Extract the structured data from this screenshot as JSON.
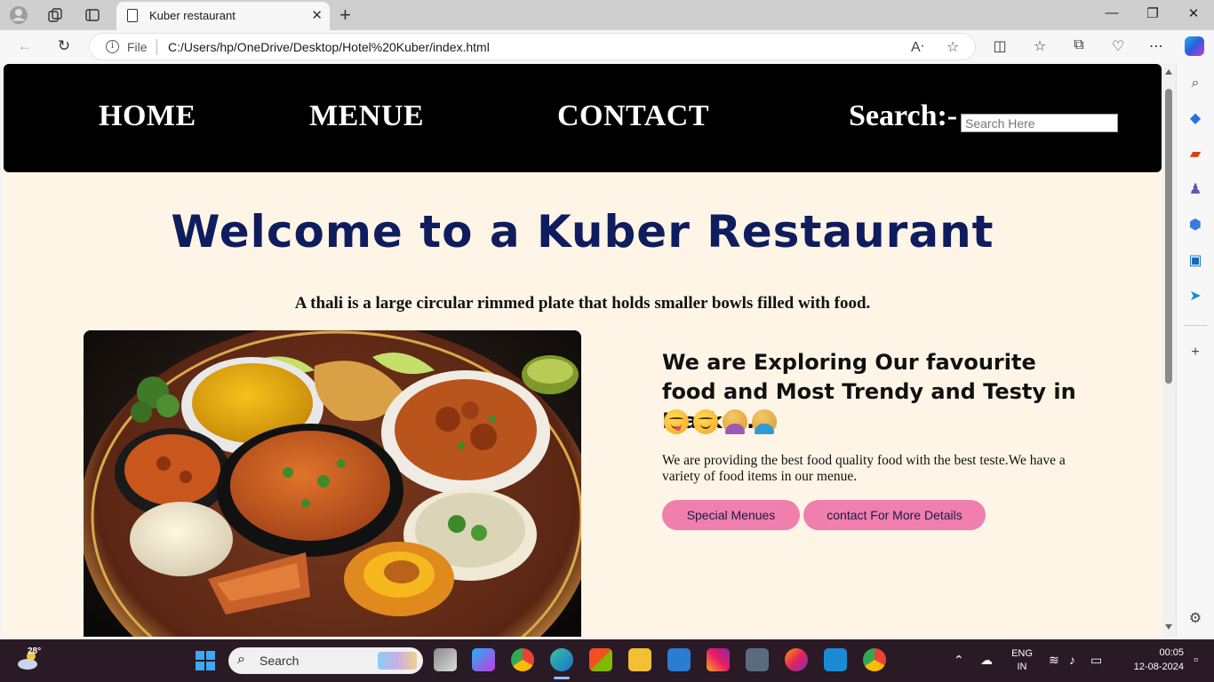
{
  "browser": {
    "tab_title": "Kuber restaurant",
    "url_scheme_label": "File",
    "url": "C:/Users/hp/OneDrive/Desktop/Hotel%20Kuber/index.html"
  },
  "site": {
    "nav": [
      "HOME",
      "MENUE",
      "CONTACT"
    ],
    "search_label": "Search:-",
    "search_placeholder": "Search Here",
    "heading": "Welcome to a Kuber Restaurant",
    "tagline": "A thali is a large circular rimmed plate that holds smaller bowls filled with food.",
    "explore_title": "We are Exploring Our favourite food and Most Trendy and Testy in Market.",
    "description": "We are providing the best food quality food with the best teste.We have a variety of food items in our menue.",
    "buttons": {
      "special": "Special Menues",
      "contact": "contact For More Details"
    },
    "food_image_alt": "thali"
  },
  "taskbar": {
    "weather_temp": "28°",
    "search_label": "Search",
    "lang_top": "ENG",
    "lang_bottom": "IN",
    "time": "00:05",
    "date": "12-08-2024"
  },
  "colors": {
    "page_bg": "#fef5e6",
    "nav_bg": "#000000",
    "heading": "#0f1d5e",
    "button_bg": "#f07fad"
  }
}
